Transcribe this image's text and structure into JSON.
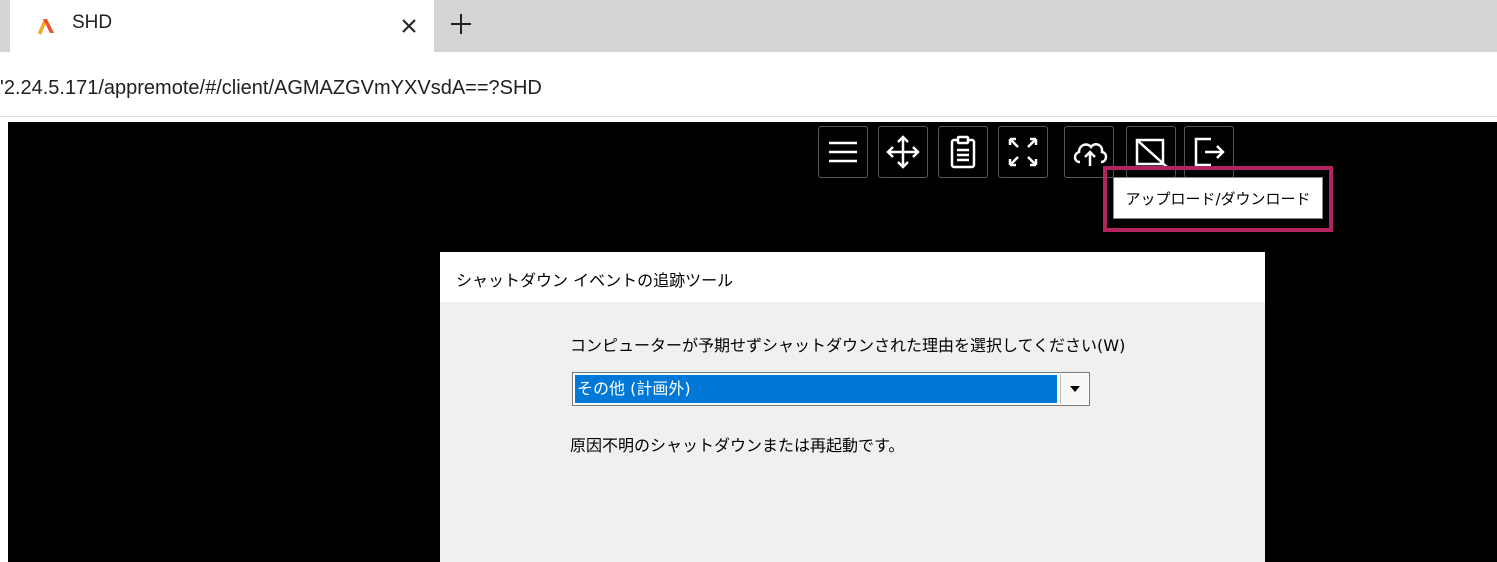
{
  "browser": {
    "tab": {
      "title": "SHD",
      "logo_icon": "triangle-logo-icon",
      "close_icon": "close-icon"
    },
    "new_tab_icon": "plus-icon",
    "address": {
      "url": "'2.24.5.171/appremote/#/client/AGMAZGVmYXVsdA==?SHD"
    }
  },
  "remote_toolbar": {
    "buttons": [
      {
        "name": "menu",
        "icon": "hamburger-menu-icon"
      },
      {
        "name": "move",
        "icon": "move-arrows-icon"
      },
      {
        "name": "clipboard",
        "icon": "clipboard-icon"
      },
      {
        "name": "fullscreen",
        "icon": "fullscreen-icon"
      },
      {
        "name": "upload-download",
        "icon": "cloud-upload-icon"
      },
      {
        "name": "screen-toggle",
        "icon": "screen-slash-icon"
      },
      {
        "name": "exit",
        "icon": "exit-arrow-icon"
      }
    ],
    "tooltip": "アップロード/ダウンロード",
    "highlight_color": "#b3245f"
  },
  "dialog": {
    "title": "シャットダウン イベントの追跡ツール",
    "prompt": "コンピューターが予期せずシャットダウンされた理由を選択してください(W)",
    "select": {
      "value": "その他 (計画外)",
      "highlight_color": "#0078d7"
    },
    "description": "原因不明のシャットダウンまたは再起動です。"
  }
}
